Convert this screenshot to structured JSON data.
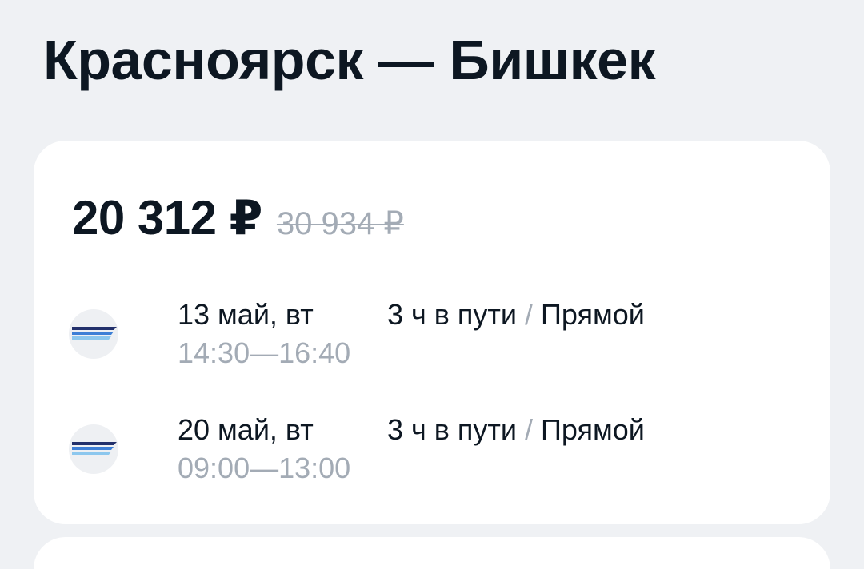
{
  "header": {
    "route_title": "Красноярск — Бишкек"
  },
  "ticket": {
    "price": "20 312 ₽",
    "old_price": "30 934 ₽",
    "segments": [
      {
        "date": "13 май, вт",
        "depart": "14:30",
        "arrive": "16:40",
        "time_separator": "—",
        "duration": "3 ч в пути",
        "separator": "/",
        "stops": "Прямой"
      },
      {
        "date": "20 май, вт",
        "depart": "09:00",
        "arrive": "13:00",
        "time_separator": "—",
        "duration": "3 ч в пути",
        "separator": "/",
        "stops": "Прямой"
      }
    ]
  },
  "icons": {
    "airline_logo": "airline-logo-icon"
  },
  "colors": {
    "background": "#eff1f4",
    "card": "#ffffff",
    "text_primary": "#0d1722",
    "text_secondary": "#a3abb5",
    "logo_dark": "#22306b",
    "logo_mid": "#3d7fd6",
    "logo_light": "#8cc7ee"
  }
}
